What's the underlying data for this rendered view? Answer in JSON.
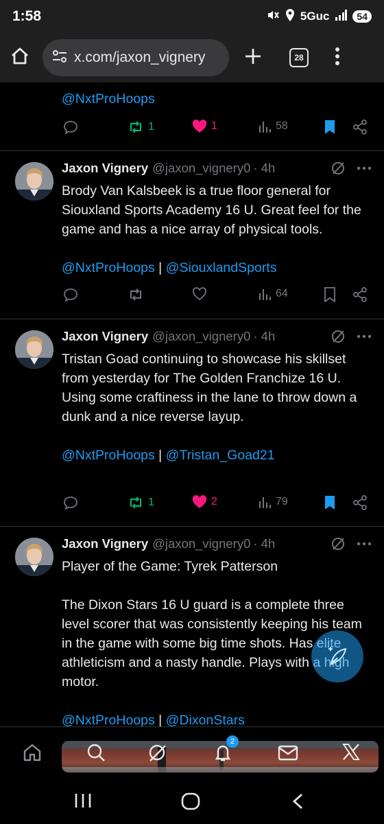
{
  "status_bar": {
    "time": "1:58",
    "network": "5Guc",
    "battery": "54"
  },
  "browser": {
    "url": "x.com/jaxon_vignery",
    "tab_count": "28"
  },
  "tweets": [
    {
      "partial": true,
      "mentions": [
        "@NxtProHoops"
      ],
      "retweets": "1",
      "likes": "1",
      "views": "58",
      "retweeted": true,
      "liked": true,
      "bookmarked": true
    },
    {
      "name": "Jaxon Vignery",
      "handle": "@jaxon_vignery0",
      "time": "· 4h",
      "text": "Brody Van Kalsbeek is a true floor general for Siouxland Sports Academy 16 U. Great feel for the game and has a nice array of physical tools.",
      "mentions": [
        "@NxtProHoops",
        "@SiouxlandSports"
      ],
      "retweets": "",
      "likes": "",
      "views": "64",
      "retweeted": false,
      "liked": false,
      "bookmarked": false
    },
    {
      "name": "Jaxon Vignery",
      "handle": "@jaxon_vignery0",
      "time": "· 4h",
      "text": "Tristan Goad continuing to showcase his skillset from yesterday for The Golden Franchize 16 U. Using some craftiness in the lane to throw down a dunk and a nice reverse layup.",
      "mentions": [
        "@NxtProHoops",
        "@Tristan_Goad21"
      ],
      "retweets": "1",
      "likes": "2",
      "views": "79",
      "retweeted": true,
      "liked": true,
      "bookmarked": true
    },
    {
      "name": "Jaxon Vignery",
      "handle": "@jaxon_vignery0",
      "time": "· 4h",
      "text_line1": "Player of the Game: Tyrek Patterson",
      "text": "The Dixon Stars 16 U guard is a complete three level scorer that was consistently keeping his team in the game with some big time shots. Has elite athleticism and a nasty handle. Plays with a high motor.",
      "mentions": [
        "@NxtProHoops",
        "@DixonStars"
      ]
    }
  ],
  "bottom_tabs": [
    "home-icon",
    "search-icon",
    "grok-icon",
    "notifications-icon",
    "messages-icon",
    "x-logo-icon"
  ],
  "notification_badge": "2",
  "colors": {
    "accent": "#1d9bf0",
    "retweet": "#00ba7c",
    "like": "#f91880",
    "muted": "#71767b"
  }
}
